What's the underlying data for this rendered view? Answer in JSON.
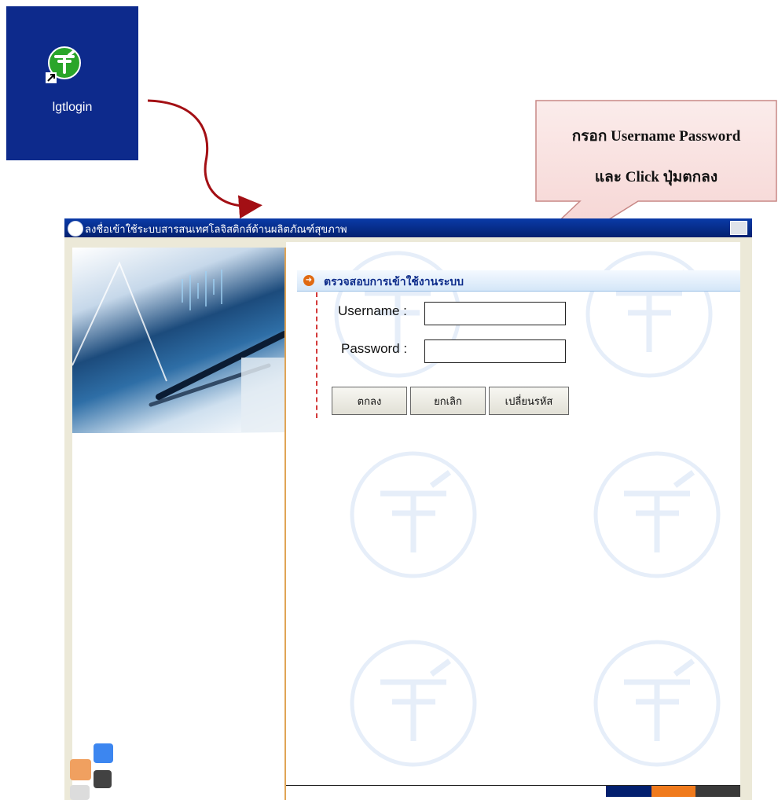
{
  "desktop_shortcut": {
    "label": "lgtlogin"
  },
  "callout": {
    "line1": "กรอก Username Password",
    "line2": "และ Click ปุ่มตกลง"
  },
  "window": {
    "title": "ลงชื่อเข้าใช้ระบบสารสนเทศโลจิสติกส์ด้านผลิตภัณฑ์สุขภาพ"
  },
  "login": {
    "section_title": "ตรวจสอบการเข้าใช้งานระบบ",
    "username_label": "Username :",
    "username_value": "",
    "password_label": "Password :",
    "password_value": ""
  },
  "buttons": {
    "ok_label": "ตกลง",
    "cancel_label": "ยกเลิก",
    "change_password_label": "เปลี่ยนรหัส"
  },
  "colors": {
    "desktop_tile": "#0d2a8c",
    "title_bar": "#03206f",
    "accent_orange": "#e06a12",
    "section_title": "#0c2b8a",
    "arrow": "#a30f14"
  }
}
